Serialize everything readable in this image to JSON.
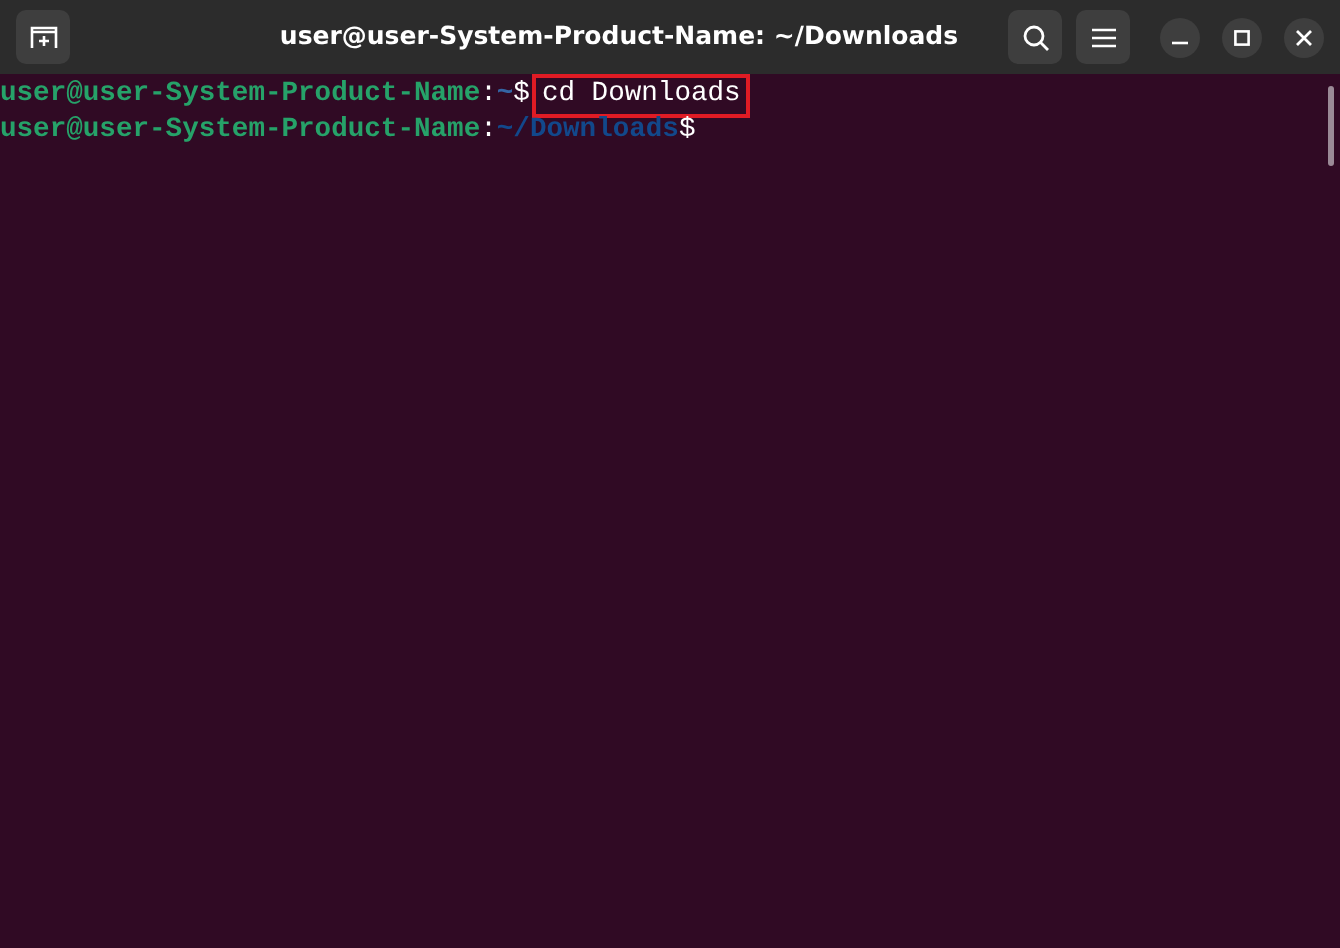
{
  "window": {
    "title": "user@user-System-Product-Name: ~/Downloads"
  },
  "lines": [
    {
      "user_host": "user@user-System-Product-Name",
      "separator": ":",
      "path": "~",
      "prompt_symbol": "$",
      "command": "cd Downloads",
      "highlighted": true
    },
    {
      "user_host": "user@user-System-Product-Name",
      "separator": ":",
      "path": "~/Downloads",
      "prompt_symbol": "$",
      "highlighted": false
    }
  ]
}
